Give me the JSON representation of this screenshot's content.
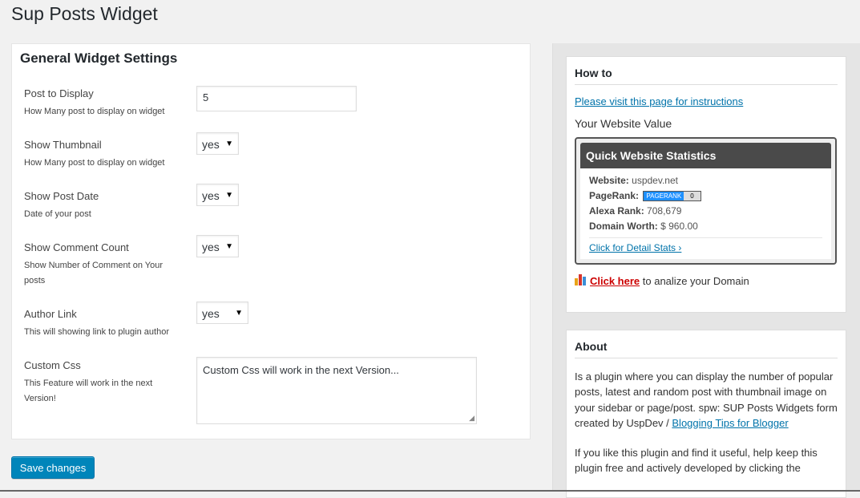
{
  "page": {
    "title": "Sup Posts Widget"
  },
  "settings": {
    "title": "General Widget Settings",
    "rows": [
      {
        "label": "Post to Display",
        "desc": "How Many post to display on widget",
        "value": "5"
      },
      {
        "label": "Show Thumbnail",
        "desc": "How Many post to display on widget",
        "value": "yes"
      },
      {
        "label": "Show Post Date",
        "desc": "Date of your post",
        "value": "yes"
      },
      {
        "label": "Show Comment Count",
        "desc": "Show Number of Comment on Your posts",
        "value": "yes"
      },
      {
        "label": "Author Link",
        "desc": "This will showing link to plugin author",
        "value": "yes"
      },
      {
        "label": "Custom Css",
        "desc": "This Feature will work in the next Version!",
        "value": "Custom Css will work in the next Version..."
      }
    ]
  },
  "actions": {
    "save_label": "Save changes"
  },
  "howto": {
    "title": "How to",
    "link": "Please visit this page for instructions",
    "value_title": "Your Website Value",
    "stats": {
      "header": "Quick Website Statistics",
      "website_label": "Website:",
      "website": "uspdev.net",
      "pagerank_label": "PageRank:",
      "pagerank_badge": "PAGERANK",
      "pagerank": "0",
      "alexa_label": "Alexa Rank:",
      "alexa": "708,679",
      "worth_label": "Domain Worth:",
      "worth": "$ 960.00",
      "detail_link": "Click for Detail Stats ›"
    },
    "analyze_link": "Click here",
    "analyze_text": " to analize your Domain"
  },
  "about": {
    "title": "About",
    "text1": "Is a plugin where you can display the number of popular posts, latest and random post with thumbnail image on your sidebar or page/post. spw: SUP Posts Widgets form created by UspDev / ",
    "link": "Blogging Tips for Blogger",
    "text2": "If you like this plugin and find it useful, help keep this plugin free and actively developed by clicking the"
  },
  "colors": {
    "primary_button": "#0085ba",
    "link": "#0073aa",
    "stats_header": "#4a4a4a",
    "analyze_link": "#cc0000"
  },
  "icons": {
    "dropdown": "caret-down",
    "resize": "resize-grip",
    "analyze": "bar-chart-icon"
  }
}
